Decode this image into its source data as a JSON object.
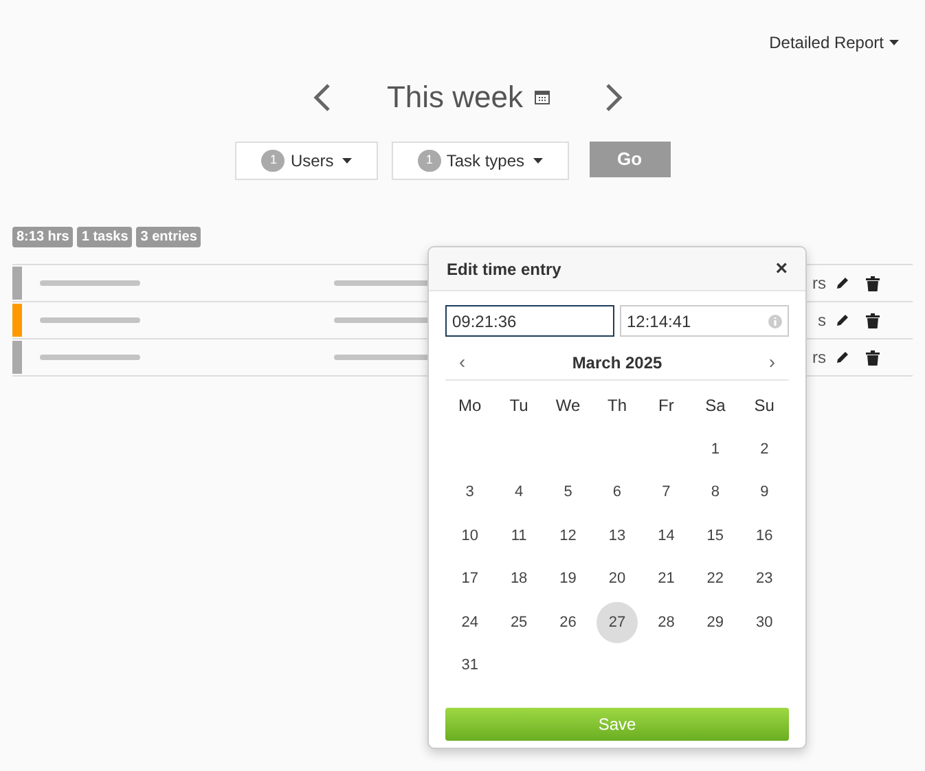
{
  "report_menu": {
    "label": "Detailed Report"
  },
  "period": {
    "title": "This week"
  },
  "filters": [
    {
      "count": "1",
      "label": "Users"
    },
    {
      "count": "1",
      "label": "Task types"
    }
  ],
  "go_button": "Go",
  "summary_badges": [
    "8:13 hrs",
    "1 tasks",
    "3 entries"
  ],
  "entries": [
    {
      "color": "#aaaaaa",
      "hours": "rs"
    },
    {
      "color": "#ff9900",
      "hours": "s"
    },
    {
      "color": "#aaaaaa",
      "hours": "rs"
    }
  ],
  "dialog": {
    "title": "Edit time entry",
    "close": "×",
    "start_time": "09:21:36",
    "end_time": "12:14:41",
    "month": "March 2025",
    "prev": "‹",
    "next": "›",
    "weekdays": [
      "Mo",
      "Tu",
      "We",
      "Th",
      "Fr",
      "Sa",
      "Su"
    ],
    "weeks": [
      {
        "kind": "tail",
        "days": [
          {
            "day": "1",
            "selected": false
          },
          {
            "day": "2",
            "selected": false
          }
        ]
      },
      {
        "kind": "full",
        "days": [
          {
            "day": "3",
            "selected": false
          },
          {
            "day": "4",
            "selected": false
          },
          {
            "day": "5",
            "selected": false
          },
          {
            "day": "6",
            "selected": false
          },
          {
            "day": "7",
            "selected": false
          },
          {
            "day": "8",
            "selected": false
          },
          {
            "day": "9",
            "selected": false
          }
        ]
      },
      {
        "kind": "full",
        "days": [
          {
            "day": "10",
            "selected": false
          },
          {
            "day": "11",
            "selected": false
          },
          {
            "day": "12",
            "selected": false
          },
          {
            "day": "13",
            "selected": false
          },
          {
            "day": "14",
            "selected": false
          },
          {
            "day": "15",
            "selected": false
          },
          {
            "day": "16",
            "selected": false
          }
        ]
      },
      {
        "kind": "full",
        "days": [
          {
            "day": "17",
            "selected": false
          },
          {
            "day": "18",
            "selected": false
          },
          {
            "day": "19",
            "selected": false
          },
          {
            "day": "20",
            "selected": false
          },
          {
            "day": "21",
            "selected": false
          },
          {
            "day": "22",
            "selected": false
          },
          {
            "day": "23",
            "selected": false
          }
        ]
      },
      {
        "kind": "full",
        "days": [
          {
            "day": "24",
            "selected": false
          },
          {
            "day": "25",
            "selected": false
          },
          {
            "day": "26",
            "selected": false
          },
          {
            "day": "27",
            "selected": true
          },
          {
            "day": "28",
            "selected": false
          },
          {
            "day": "29",
            "selected": false
          },
          {
            "day": "30",
            "selected": false
          }
        ]
      },
      {
        "kind": "head",
        "days": [
          {
            "day": "31",
            "selected": false
          }
        ]
      }
    ],
    "save": "Save"
  }
}
